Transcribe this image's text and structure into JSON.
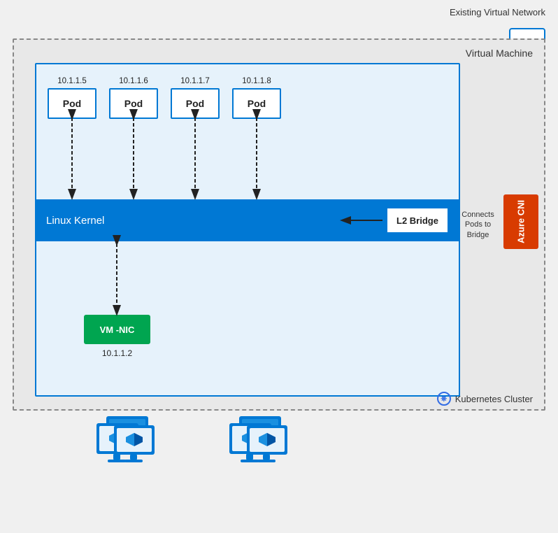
{
  "diagram": {
    "title": "Existing Virtual Network",
    "vm_label": "Virtual Machine",
    "k8s_label": "Kubernetes Cluster",
    "azure_icon": "···",
    "connects_label": "Connects Pods to Bridge",
    "pods": [
      {
        "ip": "10.1.1.5",
        "label": "Pod"
      },
      {
        "ip": "10.1.1.6",
        "label": "Pod"
      },
      {
        "ip": "10.1.1.7",
        "label": "Pod"
      },
      {
        "ip": "10.1.1.8",
        "label": "Pod"
      }
    ],
    "linux_kernel_label": "Linux Kernel",
    "l2_bridge_label": "L2 Bridge",
    "azure_cni_label": "Azure CNI",
    "vm_nic_label": "VM -NIC",
    "vm_nic_ip": "10.1.1.2"
  }
}
